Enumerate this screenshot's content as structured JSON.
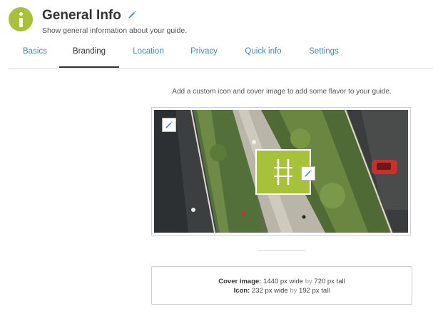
{
  "header": {
    "title": "General Info",
    "subtitle": "Show general information about your guide."
  },
  "tabs": [
    {
      "label": "Basics"
    },
    {
      "label": "Branding",
      "active": true
    },
    {
      "label": "Location"
    },
    {
      "label": "Privacy"
    },
    {
      "label": "Quick info"
    },
    {
      "label": "Settings"
    }
  ],
  "branding": {
    "intro": "Add a custom icon and cover image to add some flavor to your guide."
  },
  "dimensions": {
    "cover_label": "Cover image:",
    "cover_width": "1440 px wide",
    "cover_by": "by",
    "cover_height": "720 px tall",
    "icon_label": "Icon:",
    "icon_width": "232 px wide",
    "icon_by": "by",
    "icon_height": "192 px tall"
  },
  "colors": {
    "accent": "#a7c13b",
    "link": "#3f86c4",
    "edit_icon": "#3f86c4"
  },
  "icons": {
    "info": "info-circle-icon",
    "edit": "pencil-icon",
    "guide_logo": "rail-track-icon"
  }
}
